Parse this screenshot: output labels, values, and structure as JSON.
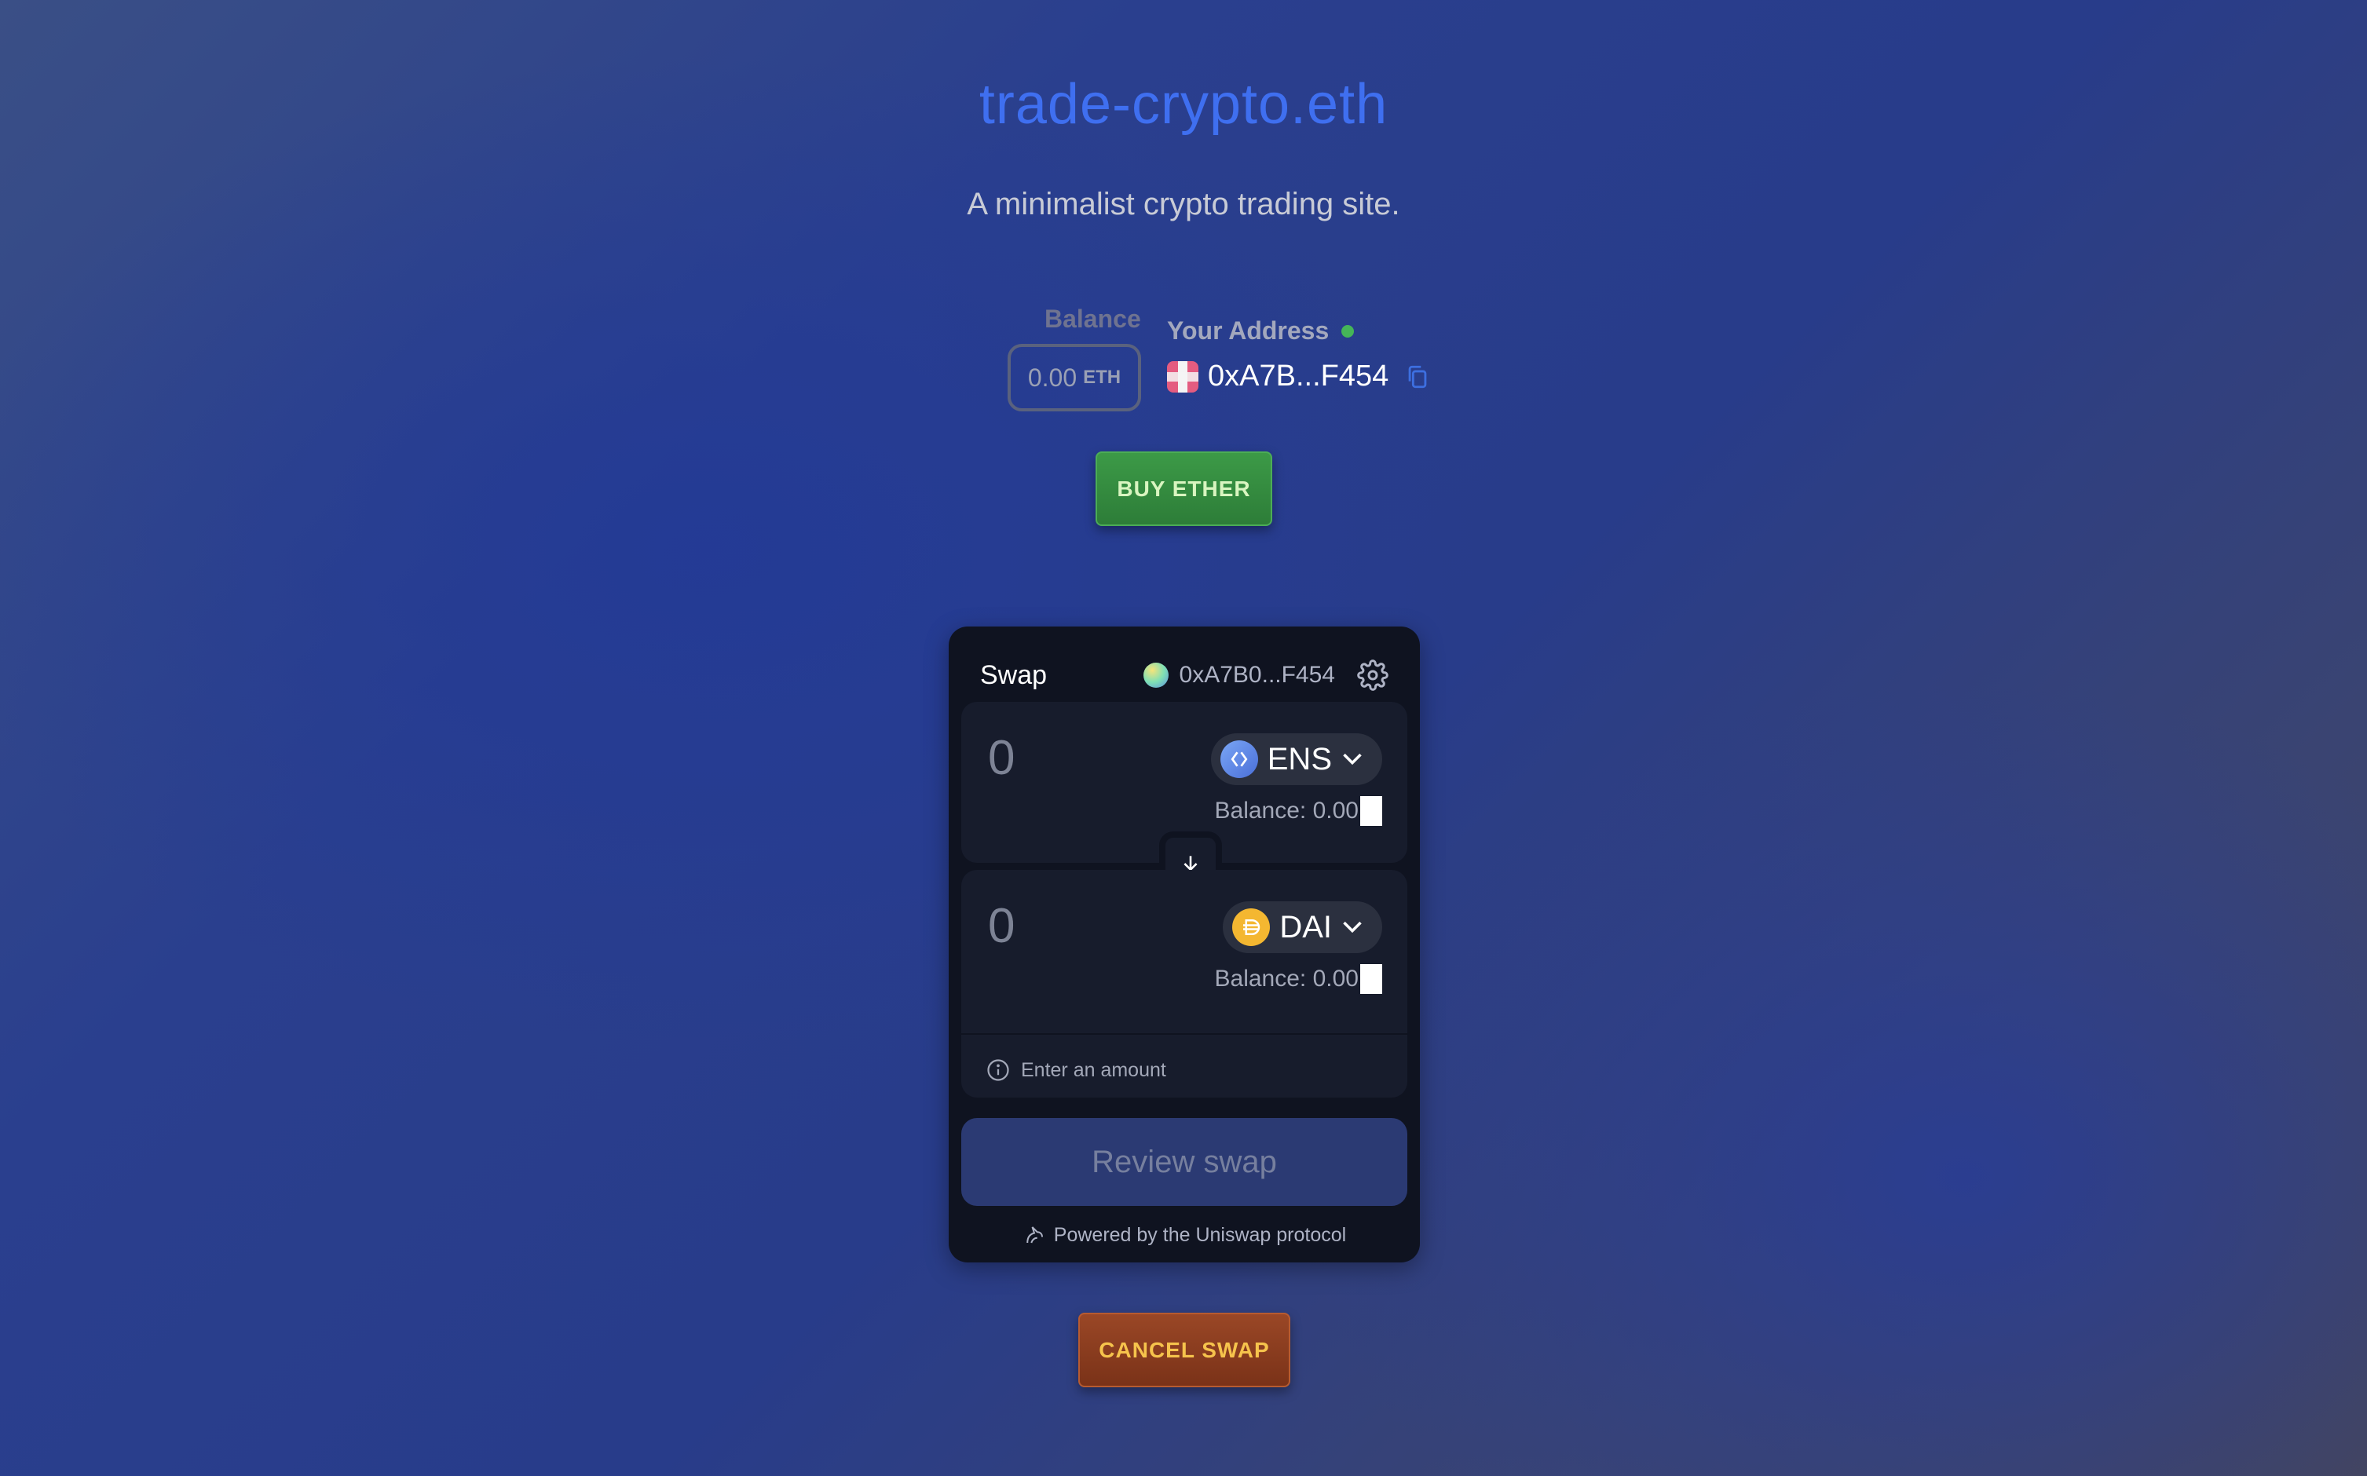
{
  "site": {
    "title": "trade-crypto.eth",
    "subtitle": "A minimalist crypto trading site."
  },
  "wallet": {
    "balance_label": "Balance",
    "balance_value": "0.00",
    "balance_unit": "ETH",
    "address_label": "Your Address",
    "address": "0xA7B...F454",
    "status_color": "#45b558"
  },
  "buttons": {
    "buy": "BUY ETHER",
    "cancel": "CANCEL SWAP"
  },
  "swap": {
    "title": "Swap",
    "account": "0xA7B0...F454",
    "from": {
      "amount": "0",
      "token": "ENS",
      "balance": "Balance: 0.00"
    },
    "to": {
      "amount": "0",
      "token": "DAI",
      "balance": "Balance: 0.00"
    },
    "hint": "Enter an amount",
    "review": "Review swap",
    "powered_by": "Powered by the Uniswap protocol"
  },
  "colors": {
    "title": "#3f6ff0",
    "buy_button": "#2d7d38",
    "cancel_button": "#7a3218",
    "widget_bg": "#0f1320"
  }
}
